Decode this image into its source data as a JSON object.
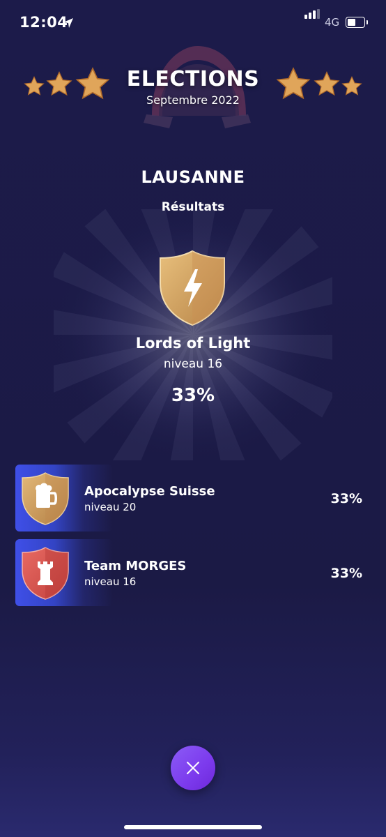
{
  "status_bar": {
    "time": "12:04",
    "network": "4G"
  },
  "header": {
    "title": "ELECTIONS",
    "subtitle": "Septembre 2022"
  },
  "city": "LAUSANNE",
  "results_label": "Résultats",
  "winner": {
    "name": "Lords of Light",
    "level": "niveau 16",
    "percent": "33%"
  },
  "teams": [
    {
      "name": "Apocalypse Suisse",
      "level": "niveau 20",
      "percent": "33%",
      "color": "#c99a5e",
      "icon": "beer-mug-icon"
    },
    {
      "name": "Team MORGES",
      "level": "niveau 16",
      "percent": "33%",
      "color": "#d9534f",
      "icon": "rook-tower-icon"
    }
  ],
  "colors": {
    "background": "#1c1b4a",
    "accent": "#7c3aed",
    "team_badge": "#3f4fe8",
    "gold": "#d9a863"
  }
}
